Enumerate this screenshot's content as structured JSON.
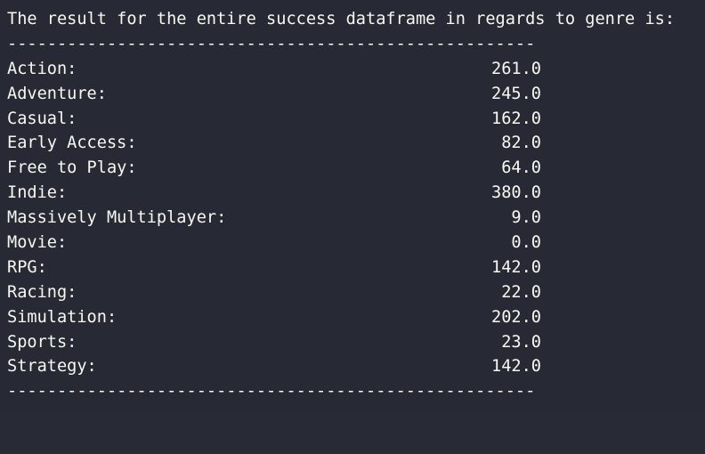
{
  "terminal": {
    "header": "The result for the entire success dataframe in regards to genre is:",
    "rule": "-----------------------------------------------------",
    "rows": [
      {
        "label": "Action:",
        "value": "261.0"
      },
      {
        "label": "Adventure:",
        "value": "245.0"
      },
      {
        "label": "Casual:",
        "value": "162.0"
      },
      {
        "label": "Early Access:",
        "value": "82.0"
      },
      {
        "label": "Free to Play:",
        "value": "64.0"
      },
      {
        "label": "Indie:",
        "value": "380.0"
      },
      {
        "label": "Massively Multiplayer:",
        "value": "9.0"
      },
      {
        "label": "Movie:",
        "value": "0.0"
      },
      {
        "label": "RPG:",
        "value": "142.0"
      },
      {
        "label": "Racing:",
        "value": "22.0"
      },
      {
        "label": "Simulation:",
        "value": "202.0"
      },
      {
        "label": "Sports:",
        "value": "23.0"
      },
      {
        "label": "Strategy:",
        "value": "142.0"
      }
    ],
    "colors": {
      "background": "#272935",
      "text": "#f8f8f2"
    }
  }
}
